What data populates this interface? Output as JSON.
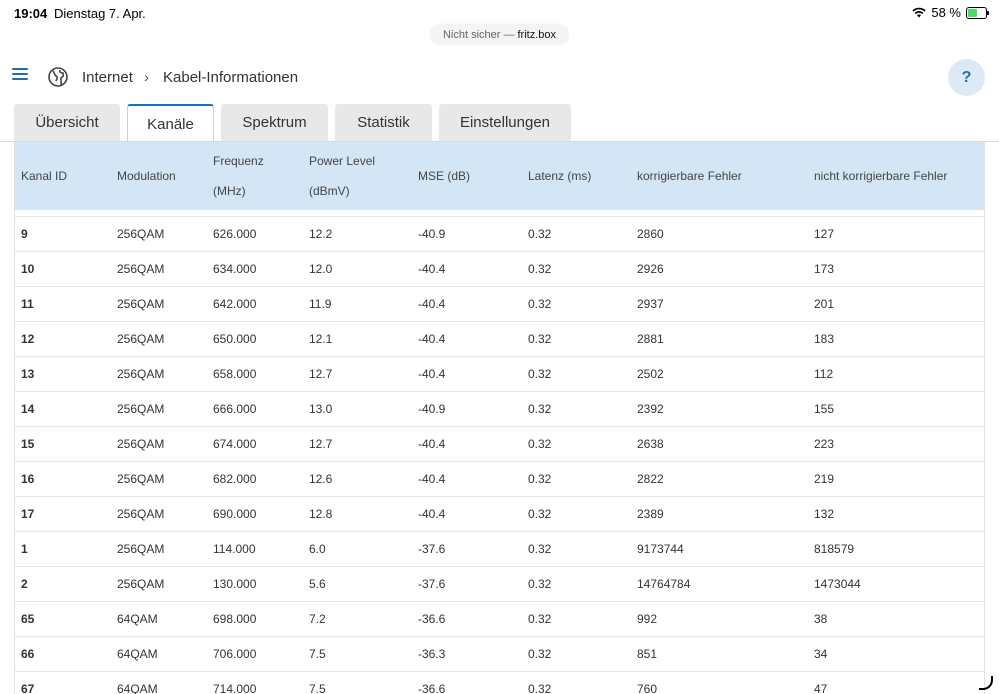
{
  "statusbar": {
    "time": "19:04",
    "date": "Dienstag 7. Apr.",
    "battery": "58 %",
    "battery_level": 0.58
  },
  "urlbar": {
    "security": "Nicht sicher —",
    "host": "fritz.box"
  },
  "breadcrumb": {
    "root": "Internet",
    "separator": "›",
    "current": "Kabel-Informationen"
  },
  "help_label": "?",
  "tabs": [
    "Übersicht",
    "Kanäle",
    "Spektrum",
    "Statistik",
    "Einstellungen"
  ],
  "active_tab": "Kanäle",
  "table": {
    "headers": [
      [
        "Kanal ID"
      ],
      [
        "Modulation"
      ],
      [
        "Frequenz",
        "(MHz)"
      ],
      [
        "Power Level",
        "(dBmV)"
      ],
      [
        "MSE (dB)"
      ],
      [
        "Latenz (ms)"
      ],
      [
        "korrigierbare Fehler"
      ],
      [
        "nicht korrigierbare Fehler"
      ]
    ],
    "rows": [
      [
        "9",
        "256QAM",
        "626.000",
        "12.2",
        "-40.9",
        "0.32",
        "2860",
        "127"
      ],
      [
        "10",
        "256QAM",
        "634.000",
        "12.0",
        "-40.4",
        "0.32",
        "2926",
        "173"
      ],
      [
        "11",
        "256QAM",
        "642.000",
        "11.9",
        "-40.4",
        "0.32",
        "2937",
        "201"
      ],
      [
        "12",
        "256QAM",
        "650.000",
        "12.1",
        "-40.4",
        "0.32",
        "2881",
        "183"
      ],
      [
        "13",
        "256QAM",
        "658.000",
        "12.7",
        "-40.4",
        "0.32",
        "2502",
        "112"
      ],
      [
        "14",
        "256QAM",
        "666.000",
        "13.0",
        "-40.9",
        "0.32",
        "2392",
        "155"
      ],
      [
        "15",
        "256QAM",
        "674.000",
        "12.7",
        "-40.4",
        "0.32",
        "2638",
        "223"
      ],
      [
        "16",
        "256QAM",
        "682.000",
        "12.6",
        "-40.4",
        "0.32",
        "2822",
        "219"
      ],
      [
        "17",
        "256QAM",
        "690.000",
        "12.8",
        "-40.4",
        "0.32",
        "2389",
        "132"
      ],
      [
        "1",
        "256QAM",
        "114.000",
        "6.0",
        "-37.6",
        "0.32",
        "9173744",
        "818579"
      ],
      [
        "2",
        "256QAM",
        "130.000",
        "5.6",
        "-37.6",
        "0.32",
        "14764784",
        "1473044"
      ],
      [
        "65",
        "64QAM",
        "698.000",
        "7.2",
        "-36.6",
        "0.32",
        "992",
        "38"
      ],
      [
        "66",
        "64QAM",
        "706.000",
        "7.5",
        "-36.3",
        "0.32",
        "851",
        "34"
      ],
      [
        "67",
        "64QAM",
        "714.000",
        "7.5",
        "-36.6",
        "0.32",
        "760",
        "47"
      ]
    ]
  },
  "colors": {
    "accent": "#1f6fb7",
    "header_bg": "#d4e6f5",
    "tab_bg": "#e8e8e8"
  }
}
